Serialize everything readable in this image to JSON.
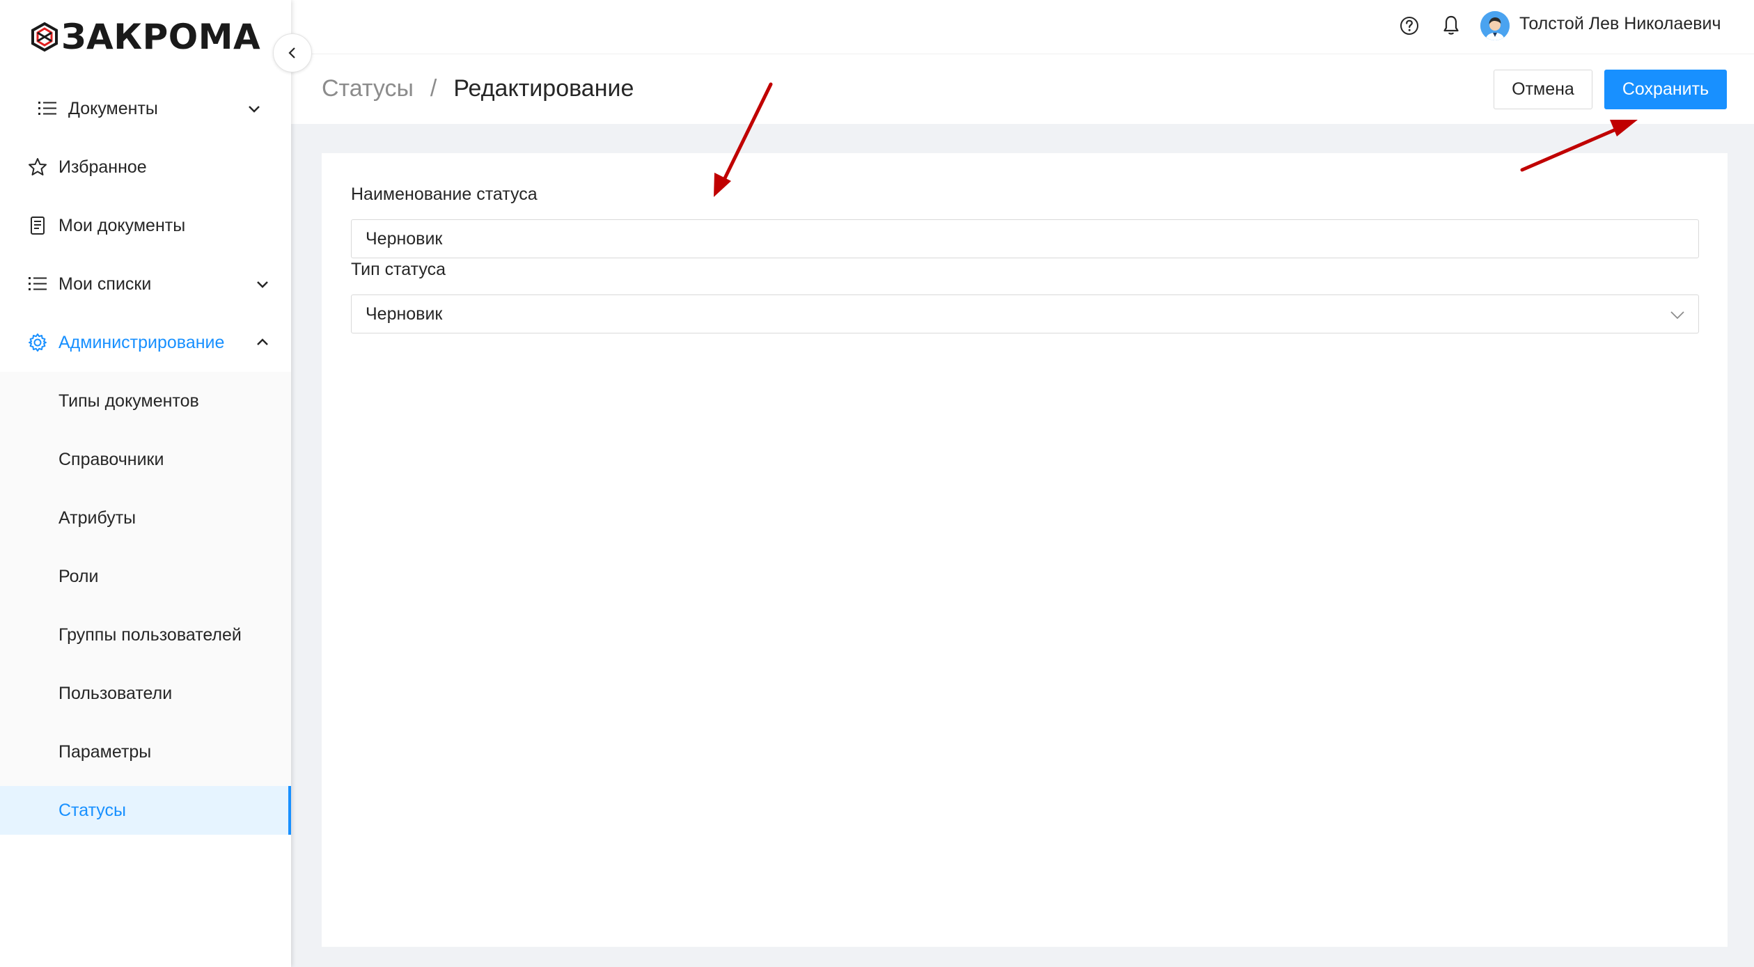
{
  "app": {
    "logo_text": "ЗАКРОМА"
  },
  "sidebar": {
    "items": [
      {
        "label": "Документы",
        "icon": "list-icon",
        "expandable": true,
        "expanded": false
      },
      {
        "label": "Избранное",
        "icon": "star-icon"
      },
      {
        "label": "Мои документы",
        "icon": "document-icon"
      },
      {
        "label": "Мои списки",
        "icon": "list-icon",
        "expandable": true,
        "expanded": false
      },
      {
        "label": "Администрирование",
        "icon": "gear-icon",
        "expandable": true,
        "expanded": true,
        "active": true
      }
    ],
    "admin_subitems": [
      {
        "label": "Типы документов"
      },
      {
        "label": "Справочники"
      },
      {
        "label": "Атрибуты"
      },
      {
        "label": "Роли"
      },
      {
        "label": "Группы пользователей"
      },
      {
        "label": "Пользователи"
      },
      {
        "label": "Параметры"
      },
      {
        "label": "Статусы",
        "selected": true
      }
    ]
  },
  "header": {
    "user_name": "Толстой Лев Николаевич",
    "breadcrumb": {
      "parent": "Статусы",
      "separator": "/",
      "current": "Редактирование"
    },
    "cancel_label": "Отмена",
    "save_label": "Сохранить"
  },
  "form": {
    "name_label": "Наименование статуса",
    "name_value": "Черновик",
    "type_label": "Тип статуса",
    "type_value": "Черновик"
  },
  "colors": {
    "accent": "#1890ff",
    "annotation": "#c00000",
    "content_bg": "#f0f2f5"
  }
}
